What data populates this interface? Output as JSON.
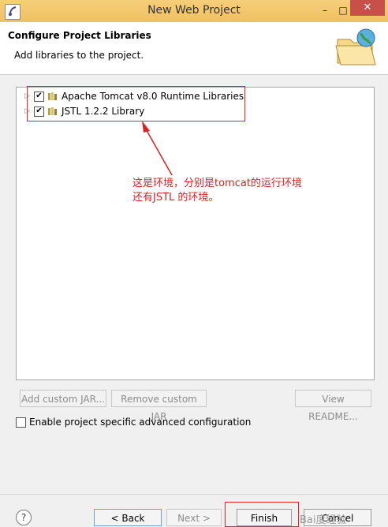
{
  "window": {
    "title": "New Web Project",
    "minimize_glyph": "–",
    "maximize_glyph": "□",
    "close_glyph": "✕"
  },
  "header": {
    "title": "Configure Project Libraries",
    "subtitle": "Add libraries to the project."
  },
  "libraries": [
    {
      "label": "Apache Tomcat v8.0 Runtime Libraries",
      "checked": true
    },
    {
      "label": "JSTL 1.2.2 Library",
      "checked": true
    }
  ],
  "annotation": {
    "line1": "这是环境，分别是tomcat的运行环境",
    "line2": "还有JSTL 的环境。"
  },
  "buttons": {
    "add_custom_jar": "Add custom JAR...",
    "remove_custom_jar": "Remove custom JAR",
    "view_readme": "View README..."
  },
  "advanced": {
    "label": "Enable project specific advanced configuration",
    "checked": false
  },
  "footer": {
    "help_glyph": "?",
    "back": "< Back",
    "next": "Next >",
    "finish": "Finish",
    "cancel": "Cancel"
  },
  "watermark": "Bai度经验",
  "colors": {
    "annotation": "#e02020",
    "title_bar": "#f0c060",
    "close_button": "#c7504b"
  }
}
